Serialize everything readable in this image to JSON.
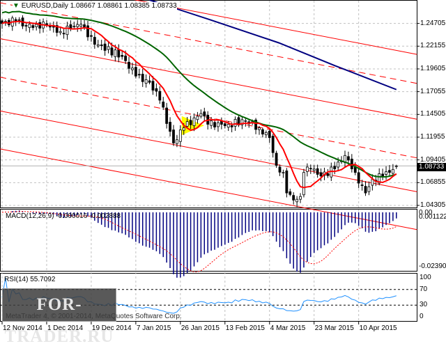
{
  "header": {
    "symbol": "EURUSD,Daily",
    "ohlc": "1.08667 1.08861 1.08385 1.08733"
  },
  "current_price": "1.08733",
  "macd_title": "MACD(12,26,9) -0.000016 -0.002888",
  "rsi_title": "RSI(14) 55.7092",
  "copyright": "MetaTrader 4, © 2001-2014, MetaQuotes Software Corp.",
  "watermark": "FOR-TRADER.RU",
  "colors": {
    "bg": "#ffffff",
    "grid": "#c0c0c0",
    "ma_fast": "#ff0000",
    "ma_slow": "#006400",
    "ma_long": "#000080",
    "channel": "#ff0000",
    "macd_hist": "#000080",
    "macd_signal": "#ff0000",
    "rsi": "#1e90ff",
    "triangle": "#ffff00"
  },
  "chart_data": {
    "type": "candlestick",
    "title": "EURUSD,Daily",
    "price_axis": {
      "ticks": [
        "1.24705",
        "1.22155",
        "1.19605",
        "1.17055",
        "1.14505",
        "1.11955",
        "1.09405",
        "1.06855",
        "1.04305"
      ],
      "range": [
        1.0407,
        1.2733
      ]
    },
    "date_ticks": [
      {
        "bar": 0,
        "label": "12 Nov 2014"
      },
      {
        "bar": 13,
        "label": "1 Dec 2014"
      },
      {
        "bar": 26,
        "label": "19 Dec 2014"
      },
      {
        "bar": 39,
        "label": "7 Jan 2015"
      },
      {
        "bar": 52,
        "label": "26 Jan 2015"
      },
      {
        "bar": 65,
        "label": "13 Feb 2015"
      },
      {
        "bar": 78,
        "label": "4 Mar 2015"
      },
      {
        "bar": 91,
        "label": "23 Mar 2015"
      },
      {
        "bar": 104,
        "label": "10 Apr 2015"
      }
    ],
    "bars_total": 116,
    "close_keypoints": [
      [
        0,
        1.247
      ],
      [
        4,
        1.25
      ],
      [
        7,
        1.244
      ],
      [
        10,
        1.246
      ],
      [
        13,
        1.245
      ],
      [
        17,
        1.238
      ],
      [
        20,
        1.242
      ],
      [
        23,
        1.246
      ],
      [
        25,
        1.232
      ],
      [
        28,
        1.223
      ],
      [
        35,
        1.21
      ],
      [
        39,
        1.188
      ],
      [
        43,
        1.181
      ],
      [
        46,
        1.161
      ],
      [
        49,
        1.126
      ],
      [
        50,
        1.113
      ],
      [
        53,
        1.13
      ],
      [
        58,
        1.146
      ],
      [
        60,
        1.134
      ],
      [
        66,
        1.134
      ],
      [
        71,
        1.138
      ],
      [
        75,
        1.13
      ],
      [
        78,
        1.119
      ],
      [
        80,
        1.088
      ],
      [
        82,
        1.08
      ],
      [
        83,
        1.057
      ],
      [
        85,
        1.049
      ],
      [
        87,
        1.053
      ],
      [
        88,
        1.08
      ],
      [
        90,
        1.084
      ],
      [
        93,
        1.076
      ],
      [
        97,
        1.084
      ],
      [
        100,
        1.099
      ],
      [
        102,
        1.084
      ],
      [
        104,
        1.068
      ],
      [
        106,
        1.057
      ],
      [
        108,
        1.072
      ],
      [
        111,
        1.076
      ],
      [
        113,
        1.08
      ],
      [
        115,
        1.08733
      ]
    ],
    "ma_long_points": [
      [
        43,
        1.2733
      ],
      [
        60.4,
        1.2515
      ],
      [
        80.7,
        1.2253
      ],
      [
        97,
        1.1998
      ],
      [
        115,
        1.1729
      ]
    ],
    "channel_lines": [
      {
        "style": "solid",
        "from": [
          -0.6,
          1.3027
        ],
        "to": [
          121,
          1.2123
        ]
      },
      {
        "style": "dashed",
        "from": [
          -0.6,
          1.2702
        ],
        "to": [
          121,
          1.1798
        ]
      },
      {
        "style": "solid",
        "from": [
          -0.6,
          1.23
        ],
        "to": [
          121,
          1.1396
        ]
      },
      {
        "style": "dashed",
        "from": [
          -0.6,
          1.1868
        ],
        "to": [
          121,
          1.0963
        ]
      },
      {
        "style": "solid",
        "from": [
          -0.6,
          1.1489
        ],
        "to": [
          121,
          1.0584
        ]
      },
      {
        "style": "solid",
        "from": [
          -0.6,
          1.1064
        ],
        "to": [
          121,
          1.0159
        ]
      }
    ],
    "triangle": [
      [
        52.5,
        1.1426
      ],
      [
        52.5,
        1.1225
      ],
      [
        58.7,
        1.1326
      ]
    ],
    "ma_fast_period": 8,
    "ma_slow_period": 30,
    "macd": {
      "fast": 12,
      "slow": 26,
      "signal": 9,
      "axis_ticks": [
        "0.00",
        "0.001122",
        "-0.023908"
      ],
      "range": [
        -0.023908,
        0.001122
      ]
    },
    "rsi": {
      "period": 14,
      "axis_ticks": [
        "100",
        "70",
        "30",
        "0"
      ],
      "levels": [
        70,
        30
      ],
      "range": [
        0,
        100
      ]
    }
  }
}
